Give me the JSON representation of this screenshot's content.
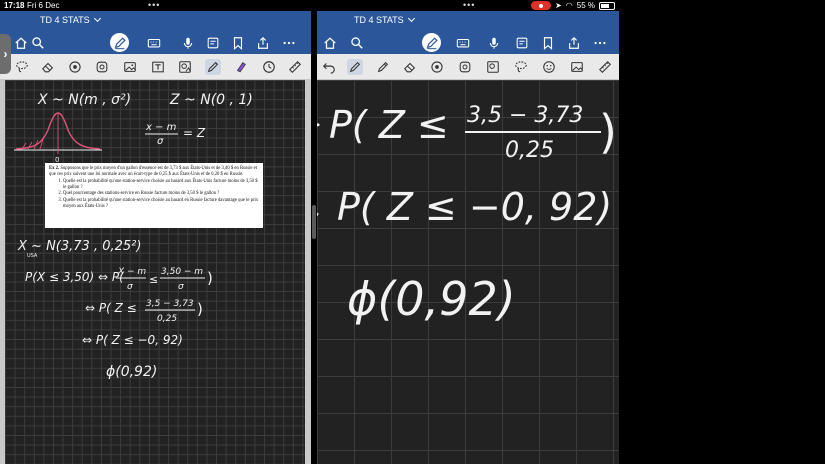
{
  "status": {
    "time": "17:18",
    "date": "Fri 6 Dec",
    "battery": "55 %"
  },
  "document": {
    "title": "TD 4 STATS"
  },
  "exercise": {
    "heading": "Ex 2.",
    "intro": "Supposons que le prix moyen d'un gallon d'essence est de 3,73 $ aux États-Unis et de 3,40 $ en Russie et que ces prix suivent une loi normale avec un écart-type de 0,25 $ aux États-Unis et de 0,20 $ en Russie.",
    "questions": [
      "Quelle est la probabilité qu'une station-service choisie au hasard aux États-Unis facture moins de 3,50 $ le gallon ?",
      "Quel pourcentage des stations-service en Russie facture moins de 3,50 $ le gallon ?",
      "Quelle est la probabilité qu'une station-service choisie au hasard en Russie facture davantage que le prix moyen aux États-Unis ?"
    ]
  },
  "left_notes": {
    "line1_a": "X ~ N(m , σ²)",
    "line1_b": "Z ~ N(0 , 1)",
    "fraction_num": "x − m",
    "fraction_den": "σ",
    "fraction_eq": "= Z",
    "bell_zero": "0",
    "line2": "X  ~ N(3,73 , 0,25²)",
    "line2_sub": "USA",
    "line3_a": "P(X ≤ 3,50) ⇔ P(",
    "line3_num1": "X − m",
    "line3_den1": "σ",
    "line3_le": "≤",
    "line3_num2": "3,50 − m",
    "line3_den2": "σ",
    "line3_close": ")",
    "line4_a": "⇔ P( Z ≤",
    "line4_num": "3,5 − 3,73",
    "line4_den": "0,25",
    "line4_close": ")",
    "line5": "⇔ P( Z ≤ −0, 92)",
    "line6": "ϕ(0,92)"
  },
  "right_notes": {
    "line1_a": "P( Z ≤",
    "line1_num": "3,5 − 3,73",
    "line1_den": "0,25",
    "line1_close": ")",
    "line2": "P( Z ≤ −0, 92)",
    "line3": "ϕ(0,92)"
  },
  "colors": {
    "ribbon": "#2b579a",
    "toolbar": "#e9e9e9",
    "page": "#222222",
    "grid": "#3d3d3d",
    "ink": "#f2f2f2",
    "bell_curve": "#e2557a"
  },
  "icons": {
    "ribbon_left": [
      "home-icon",
      "search-icon",
      "pen-icon",
      "keyboard-icon",
      "microphone-icon",
      "bookmark-icon",
      "share-icon",
      "more-icon"
    ],
    "ribbon_right": [
      "home-icon",
      "search-icon",
      "pen-icon",
      "keyboard-icon",
      "microphone-icon",
      "bookmark-icon",
      "share-icon",
      "more-icon"
    ]
  }
}
